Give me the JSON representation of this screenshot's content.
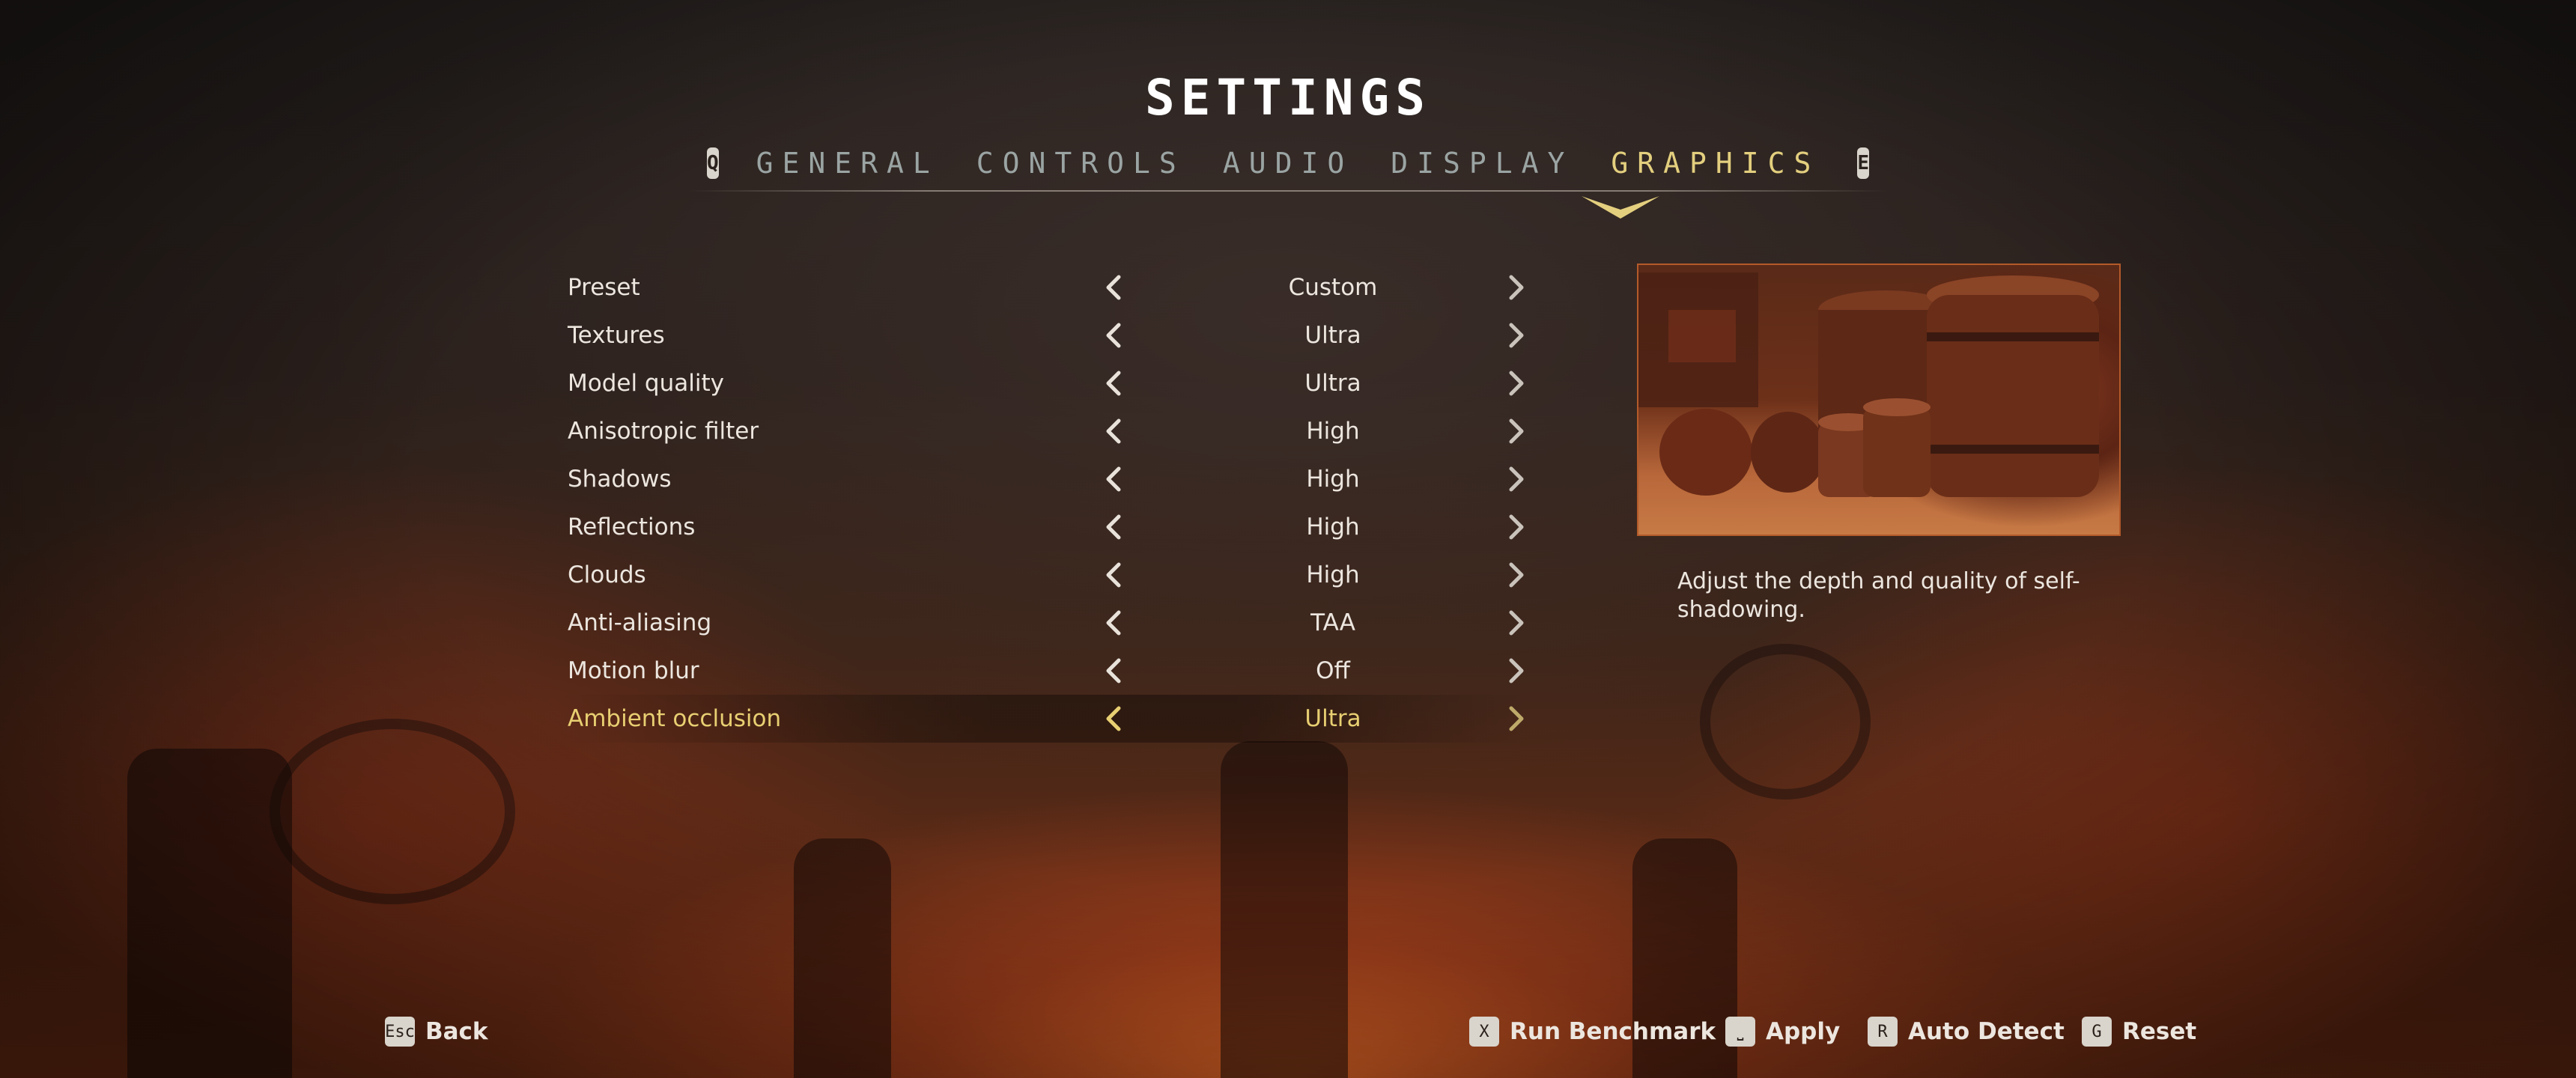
{
  "title": "SETTINGS",
  "tabs": {
    "prev_key": "Q",
    "next_key": "E",
    "items": [
      {
        "label": "GENERAL"
      },
      {
        "label": "CONTROLS"
      },
      {
        "label": "AUDIO"
      },
      {
        "label": "DISPLAY"
      },
      {
        "label": "GRAPHICS",
        "active": true
      }
    ]
  },
  "settings": [
    {
      "label": "Preset",
      "value": "Custom"
    },
    {
      "label": "Textures",
      "value": "Ultra"
    },
    {
      "label": "Model quality",
      "value": "Ultra"
    },
    {
      "label": "Anisotropic filter",
      "value": "High"
    },
    {
      "label": "Shadows",
      "value": "High"
    },
    {
      "label": "Reflections",
      "value": "High"
    },
    {
      "label": "Clouds",
      "value": "High"
    },
    {
      "label": "Anti-aliasing",
      "value": "TAA"
    },
    {
      "label": "Motion blur",
      "value": "Off"
    },
    {
      "label": "Ambient occlusion",
      "value": "Ultra",
      "selected": true
    }
  ],
  "description": "Adjust the depth and quality of self-shadowing.",
  "footer": {
    "back": {
      "key": "Esc",
      "label": "Back"
    },
    "run_benchmark": {
      "key": "X",
      "label": "Run Benchmark"
    },
    "apply": {
      "key": "⎵",
      "label": "Apply"
    },
    "auto_detect": {
      "key": "R",
      "label": "Auto Detect"
    },
    "reset": {
      "key": "G",
      "label": "Reset"
    }
  },
  "colors": {
    "accent": "#e3cf7e",
    "tab_inactive": "#9aa4a3",
    "text": "#ece6df"
  }
}
